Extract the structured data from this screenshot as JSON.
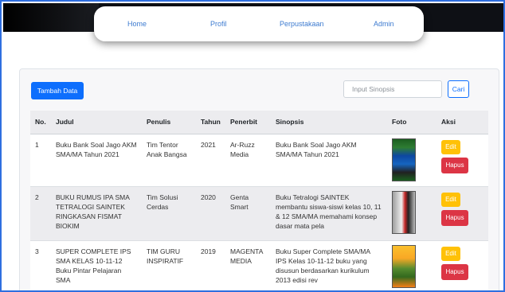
{
  "nav": {
    "items": [
      "Home",
      "Profil",
      "Perpustakaan",
      "Admin"
    ]
  },
  "toolbar": {
    "add_label": "Tambah Data",
    "search_placeholder": "Input Sinopsis",
    "search_button": "Cari"
  },
  "table": {
    "headers": [
      "No.",
      "Judul",
      "Penulis",
      "Tahun",
      "Penerbit",
      "Sinopsis",
      "Foto",
      "Aksi"
    ],
    "rows": [
      {
        "no": "1",
        "judul": "Buku Bank Soal Jago AKM SMA/MA Tahun 2021",
        "penulis": "Tim Tentor Anak Bangsa",
        "tahun": "2021",
        "penerbit": "Ar-Ruzz Media",
        "sinopsis": "Buku Bank Soal Jago AKM SMA/MA Tahun 2021"
      },
      {
        "no": "2",
        "judul": "BUKU RUMUS IPA SMA TETRALOGI SAINTEK RINGKASAN FISMAT BIOKIM",
        "penulis": "Tim Solusi Cerdas",
        "tahun": "2020",
        "penerbit": "Genta Smart",
        "sinopsis": "Buku Tetralogi SAINTEK membantu siswa-siswi kelas 10, 11 & 12 SMA/MA memahami konsep dasar mata pela"
      },
      {
        "no": "3",
        "judul": "SUPER COMPLETE IPS SMA KELAS 10-11-12 Buku Pintar Pelajaran SMA",
        "penulis": "TIM GURU INSPIRATIF",
        "tahun": "2019",
        "penerbit": "MAGENTA MEDIA",
        "sinopsis": "Buku Super Complete SMA/MA IPS Kelas 10-11-12 buku yang disusun berdasarkan kurikulum 2013 edisi rev"
      }
    ],
    "edit_label": "Edit",
    "delete_label": "Hapus"
  }
}
